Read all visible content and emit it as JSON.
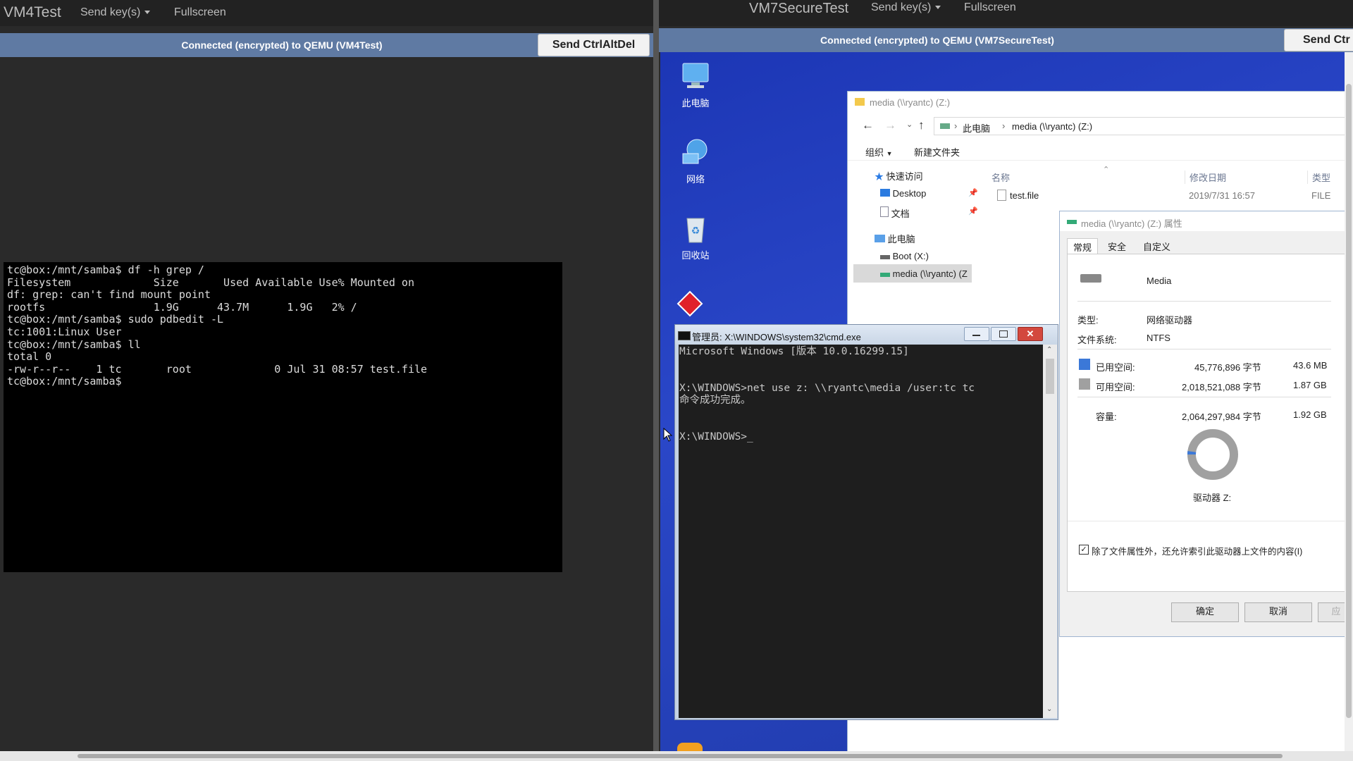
{
  "left": {
    "brand": "VM4Test",
    "send_keys": "Send key(s)",
    "fullscreen": "Fullscreen",
    "status": "Connected (encrypted) to QEMU (VM4Test)",
    "send_cad": "Send CtrlAltDel",
    "terminal_lines": [
      "tc@box:/mnt/samba$ df -h grep /",
      "Filesystem             Size       Used Available Use% Mounted on",
      "df: grep: can't find mount point",
      "rootfs                 1.9G      43.7M      1.9G   2% /",
      "tc@box:/mnt/samba$ sudo pdbedit -L",
      "tc:1001:Linux User",
      "tc@box:/mnt/samba$ ll",
      "total 0",
      "-rw-r--r--    1 tc       root             0 Jul 31 08:57 test.file",
      "tc@box:/mnt/samba$"
    ]
  },
  "right": {
    "brand": "VM7SecureTest",
    "send_keys": "Send key(s)",
    "fullscreen": "Fullscreen",
    "status": "Connected (encrypted) to QEMU (VM7SecureTest)",
    "send_cad": "Send Ctr",
    "desktop_icons": [
      {
        "label": "此电脑",
        "icon": "computer-icon"
      },
      {
        "label": "网络",
        "icon": "network-icon"
      },
      {
        "label": "回收站",
        "icon": "recycle-bin-icon"
      }
    ],
    "explorer": {
      "title": "media (\\\\ryantc) (Z:)",
      "breadcrumb": [
        "此电脑",
        "media (\\\\ryantc) (Z:)"
      ],
      "toolbar": {
        "organize": "组织",
        "new_folder": "新建文件夹"
      },
      "nav": [
        {
          "label": "快速访问",
          "icon": "star-icon"
        },
        {
          "label": "Desktop",
          "icon": "desktop-folder-icon"
        },
        {
          "label": "文档",
          "icon": "document-icon"
        },
        {
          "label": "此电脑",
          "icon": "computer-icon"
        },
        {
          "label": "Boot (X:)",
          "icon": "drive-icon"
        },
        {
          "label": "media (\\\\ryantc) (Z",
          "icon": "network-drive-icon"
        }
      ],
      "columns": [
        "名称",
        "修改日期",
        "类型"
      ],
      "files": [
        {
          "name": "test.file",
          "modified": "2019/7/31 16:57",
          "type": "FILE"
        }
      ]
    },
    "cmd": {
      "title": "管理员: X:\\WINDOWS\\system32\\cmd.exe",
      "lines": [
        "Microsoft Windows [版本 10.0.16299.15]",
        "",
        "X:\\WINDOWS>net use z: \\\\ryantc\\media /user:tc tc",
        "命令成功完成。",
        "",
        "X:\\WINDOWS>_"
      ]
    },
    "properties": {
      "title": "media (\\\\ryantc) (Z:) 属性",
      "tabs": [
        "常规",
        "安全",
        "自定义"
      ],
      "volume_name": "Media",
      "type_label": "类型:",
      "type_value": "网络驱动器",
      "fs_label": "文件系统:",
      "fs_value": "NTFS",
      "used_label": "已用空间:",
      "used_bytes": "45,776,896 字节",
      "used_size": "43.6 MB",
      "free_label": "可用空间:",
      "free_bytes": "2,018,521,088 字节",
      "free_size": "1.87 GB",
      "capacity_label": "容量:",
      "capacity_bytes": "2,064,297,984 字节",
      "capacity_size": "1.92 GB",
      "used_fraction": 0.022,
      "drive_label": "驱动器 Z:",
      "index_checkbox": "除了文件属性外，还允许索引此驱动器上文件的内容(I)",
      "ok": "确定",
      "cancel": "取消",
      "apply": "应"
    },
    "colors": {
      "used": "#3b78d8",
      "free": "#a0a0a0"
    }
  }
}
